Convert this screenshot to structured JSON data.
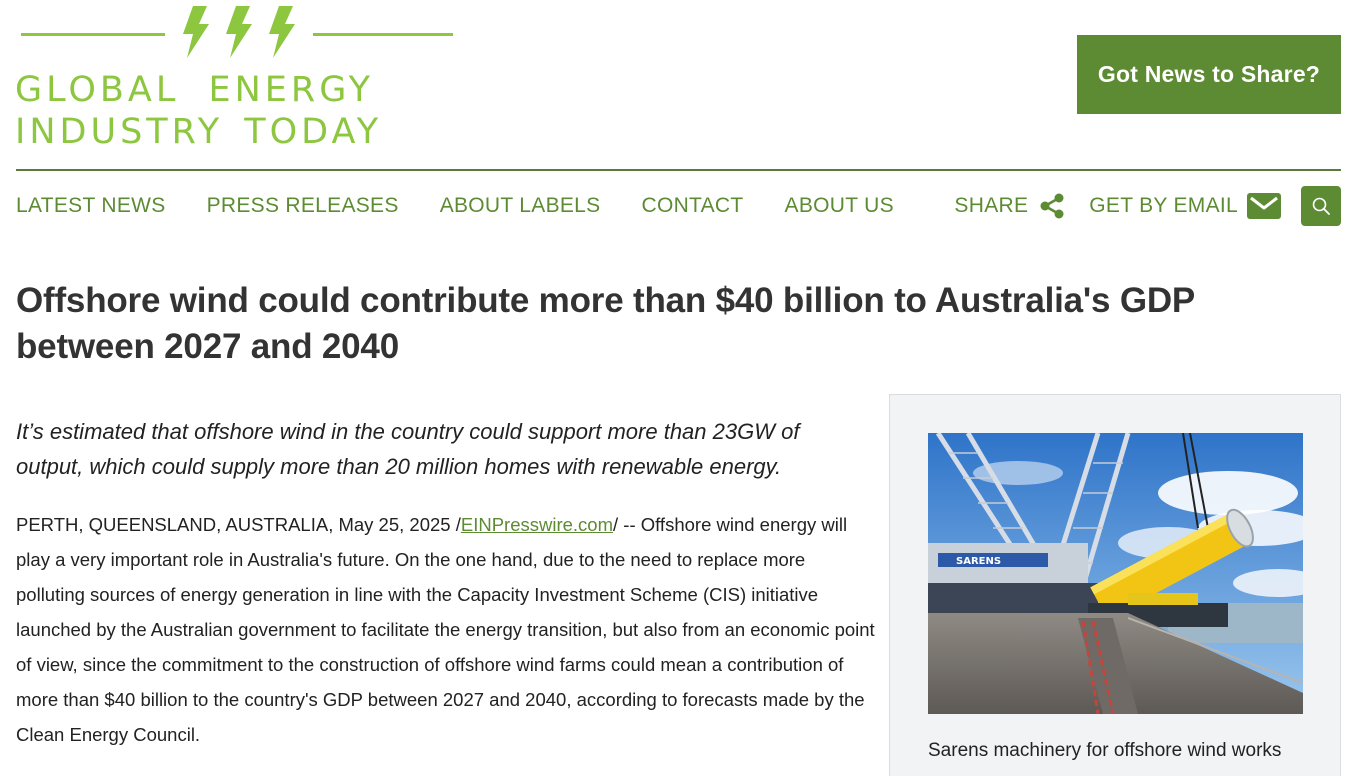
{
  "logo": {
    "line1": "GLOBAL ENERGY",
    "line2": "INDUSTRY TODAY",
    "icon": "lightning-bolts-icon"
  },
  "header": {
    "cta_label": "Got News to Share?"
  },
  "nav": {
    "items": [
      "LATEST NEWS",
      "PRESS RELEASES",
      "ABOUT LABELS",
      "CONTACT",
      "ABOUT US"
    ],
    "share_label": "SHARE",
    "email_label": "GET BY EMAIL"
  },
  "article": {
    "headline": "Offshore wind could contribute more than $40 billion to Australia's GDP between 2027 and 2040",
    "lede": "It’s estimated that offshore wind in the country could support more than 23GW of output, which could supply more than 20 million homes with renewable energy.",
    "dateline": "PERTH, QUEENSLAND, AUSTRALIA, May 25, 2025 /",
    "source_link": "EINPresswire.com",
    "body_rest": "/ -- Offshore wind energy will play a very important role in Australia's future. On the one hand, due to the need to replace more polluting sources of energy generation in line with the Capacity Investment Scheme (CIS) initiative launched by the Australian government to facilitate the energy transition, but also from an economic point of view, since the commitment to the construction of offshore wind farms could mean a contribution of more than $40 billion to the country's GDP between 2027 and 2040, according to forecasts made by the Clean Energy Council."
  },
  "sidebar": {
    "caption": "Sarens machinery for offshore wind works",
    "photo_text": "SARENS"
  },
  "colors": {
    "brand_green": "#5d8b33",
    "logo_green": "#8dc63f"
  }
}
